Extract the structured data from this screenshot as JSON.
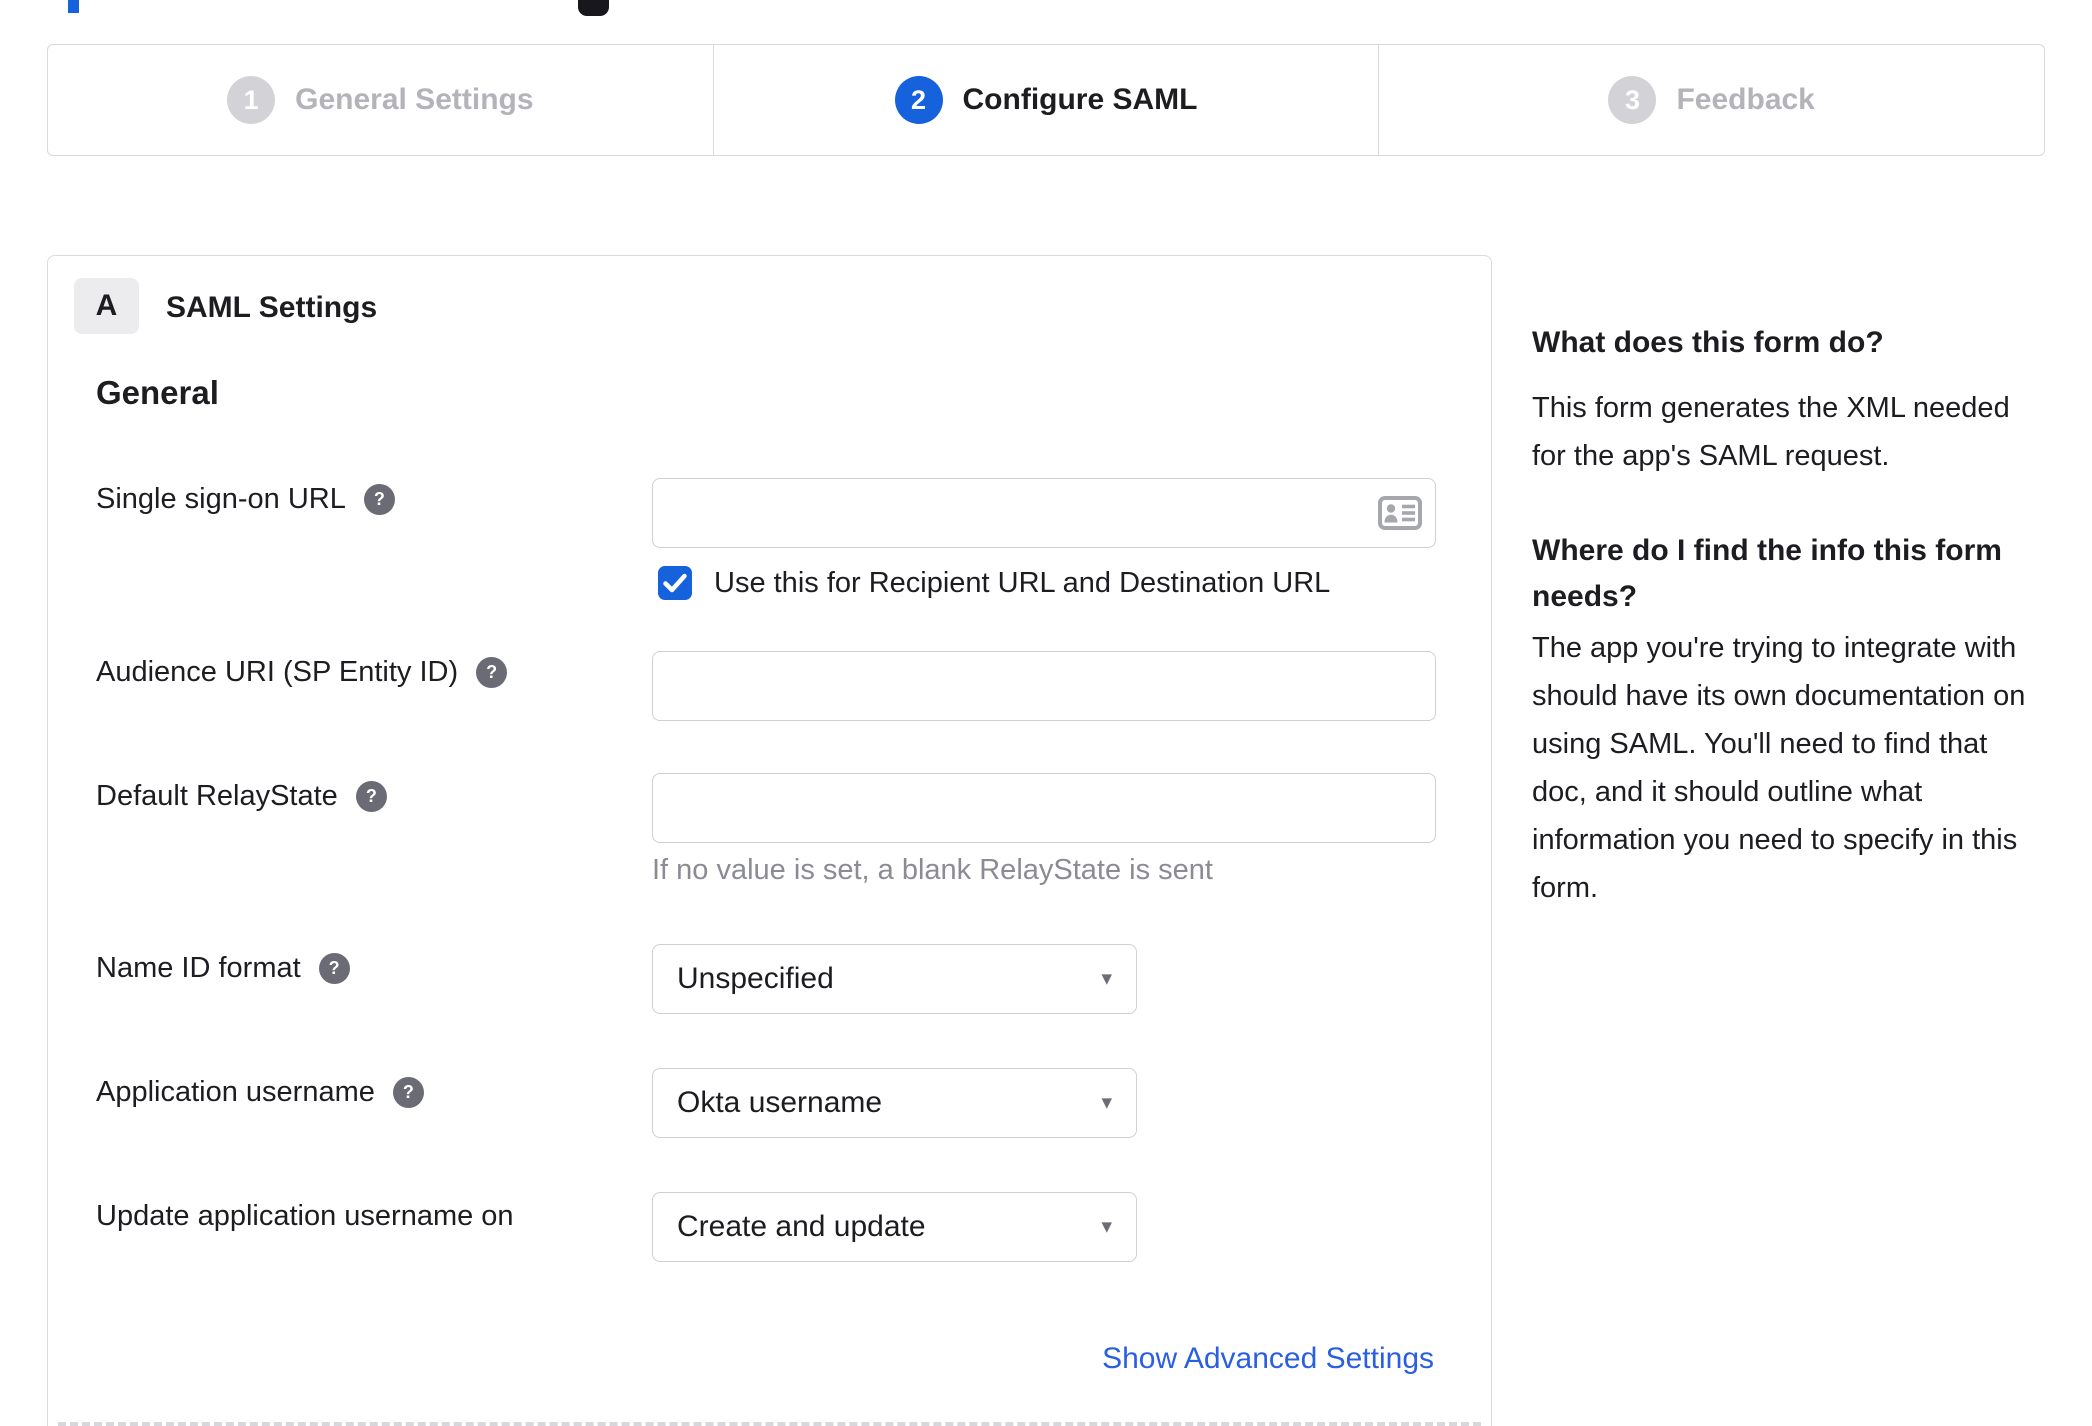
{
  "stepper": {
    "steps": [
      {
        "number": "1",
        "label": "General Settings",
        "state": "inactive"
      },
      {
        "number": "2",
        "label": "Configure SAML",
        "state": "active"
      },
      {
        "number": "3",
        "label": "Feedback",
        "state": "inactive"
      }
    ]
  },
  "panel": {
    "badge": "A",
    "title": "SAML Settings",
    "heading": "General",
    "sso": {
      "label": "Single sign-on URL",
      "value": ""
    },
    "sso_checkbox": {
      "label": "Use this for Recipient URL and Destination URL",
      "checked": true
    },
    "audience": {
      "label": "Audience URI (SP Entity ID)",
      "value": ""
    },
    "relay": {
      "label": "Default RelayState",
      "value": "",
      "hint": "If no value is set, a blank RelayState is sent"
    },
    "nameid": {
      "label": "Name ID format",
      "value": "Unspecified"
    },
    "appuser": {
      "label": "Application username",
      "value": "Okta username"
    },
    "updateuser": {
      "label": "Update application username on",
      "value": "Create and update"
    },
    "advanced_link": "Show Advanced Settings"
  },
  "sidebar": {
    "q1": "What does this form do?",
    "a1_lines": [
      "This form generates the XML needed",
      "for the app's SAML request."
    ],
    "q2_lines": [
      "Where do I find the info this form",
      "needs?"
    ],
    "a2_lines": [
      "The app you're trying to integrate with",
      "should have its own documentation on",
      "using SAML. You'll need to find that",
      "doc, and it should outline what",
      "information you need to specify in this",
      "form."
    ]
  },
  "icons": {
    "help": "?",
    "dropdown": "▾"
  },
  "colors": {
    "accent_blue": "#1662dd",
    "link_blue": "#2a60e0",
    "inactive_circle": "#d2d2d7",
    "inactive_text": "#b3b3b9",
    "border_gray": "#d9d9de",
    "hint_gray": "#8b8b93"
  }
}
